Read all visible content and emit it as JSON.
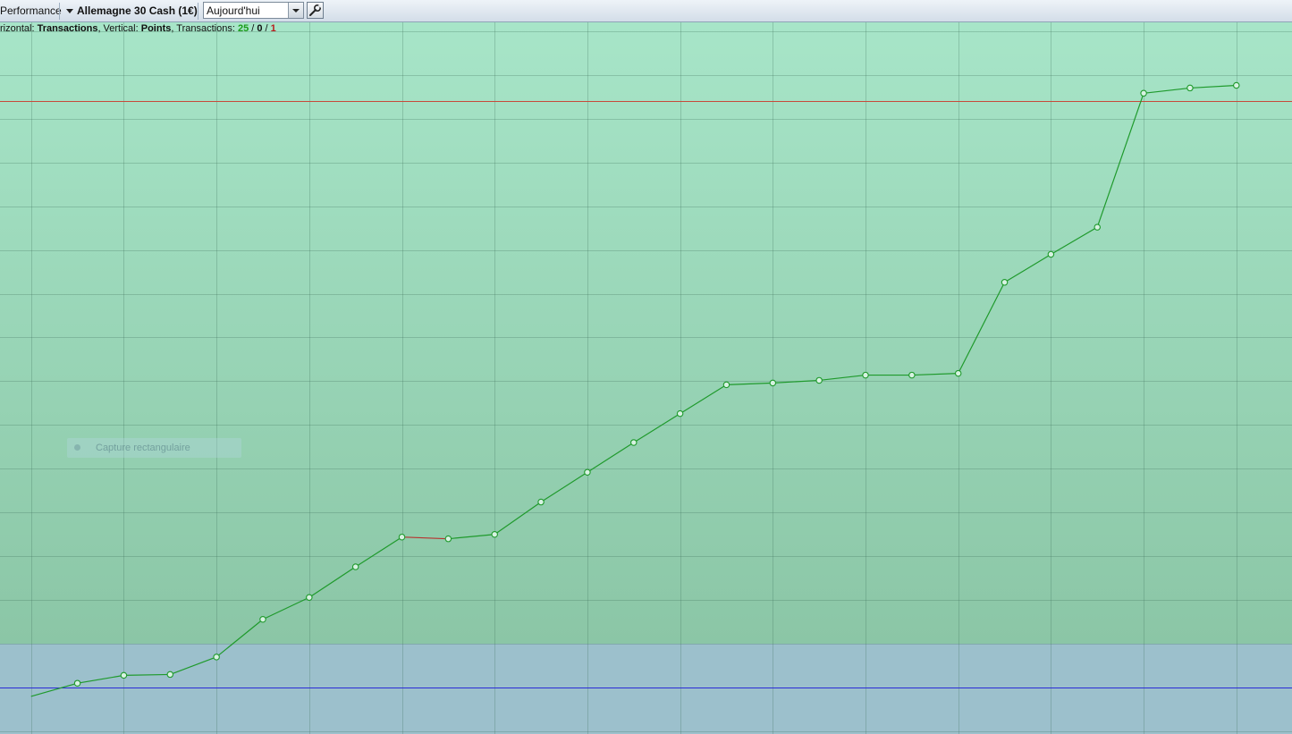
{
  "toolbar": {
    "performance_label": "Performance",
    "instrument_label": "Allemagne 30 Cash (1€)",
    "period_value": "Aujourd'hui"
  },
  "info": {
    "horizontal_prefix": "rizontal: ",
    "horizontal_value": "Transactions",
    "vertical_prefix": ", Vertical: ",
    "vertical_value": "Points",
    "transactions_prefix": ", Transactions: ",
    "wins": "25",
    "ties": "0",
    "losses": "1",
    "slash": " / "
  },
  "overlay": {
    "capture_label": "Capture rectangulaire"
  },
  "colors": {
    "profit_zone": "#a6e3c6",
    "loss_zone": "#9cc0cc",
    "gain_line": "#1f9a2c",
    "loss_line": "#b8322e",
    "target_line": "#c84a3a",
    "baseline": "#2b2bd6"
  },
  "chart_data": {
    "type": "line",
    "x": [
      0,
      1,
      2,
      3,
      4,
      5,
      6,
      7,
      8,
      9,
      10,
      11,
      12,
      13,
      14,
      15,
      16,
      17,
      18,
      19,
      20,
      21,
      22,
      23,
      24,
      25,
      26
    ],
    "values": [
      -1.0,
      0.5,
      1.4,
      1.5,
      3.5,
      7.8,
      10.3,
      13.8,
      17.2,
      17.0,
      17.5,
      21.2,
      24.6,
      28.0,
      31.3,
      34.6,
      34.8,
      35.1,
      35.7,
      35.7,
      35.9,
      46.3,
      49.5,
      52.6,
      67.9,
      68.5,
      68.8
    ],
    "segment_results": [
      "win",
      "win",
      "win",
      "win",
      "win",
      "win",
      "win",
      "win",
      "loss",
      "win",
      "win",
      "win",
      "win",
      "win",
      "win",
      "win",
      "win",
      "win",
      "win",
      "win",
      "win",
      "win",
      "win",
      "win",
      "win",
      "win"
    ],
    "reference_lines": {
      "baseline": 0,
      "target": 67
    },
    "xlim": [
      -0.67,
      27.2
    ],
    "ylim": [
      -5.3,
      76
    ],
    "grid": true,
    "legend": "none"
  }
}
